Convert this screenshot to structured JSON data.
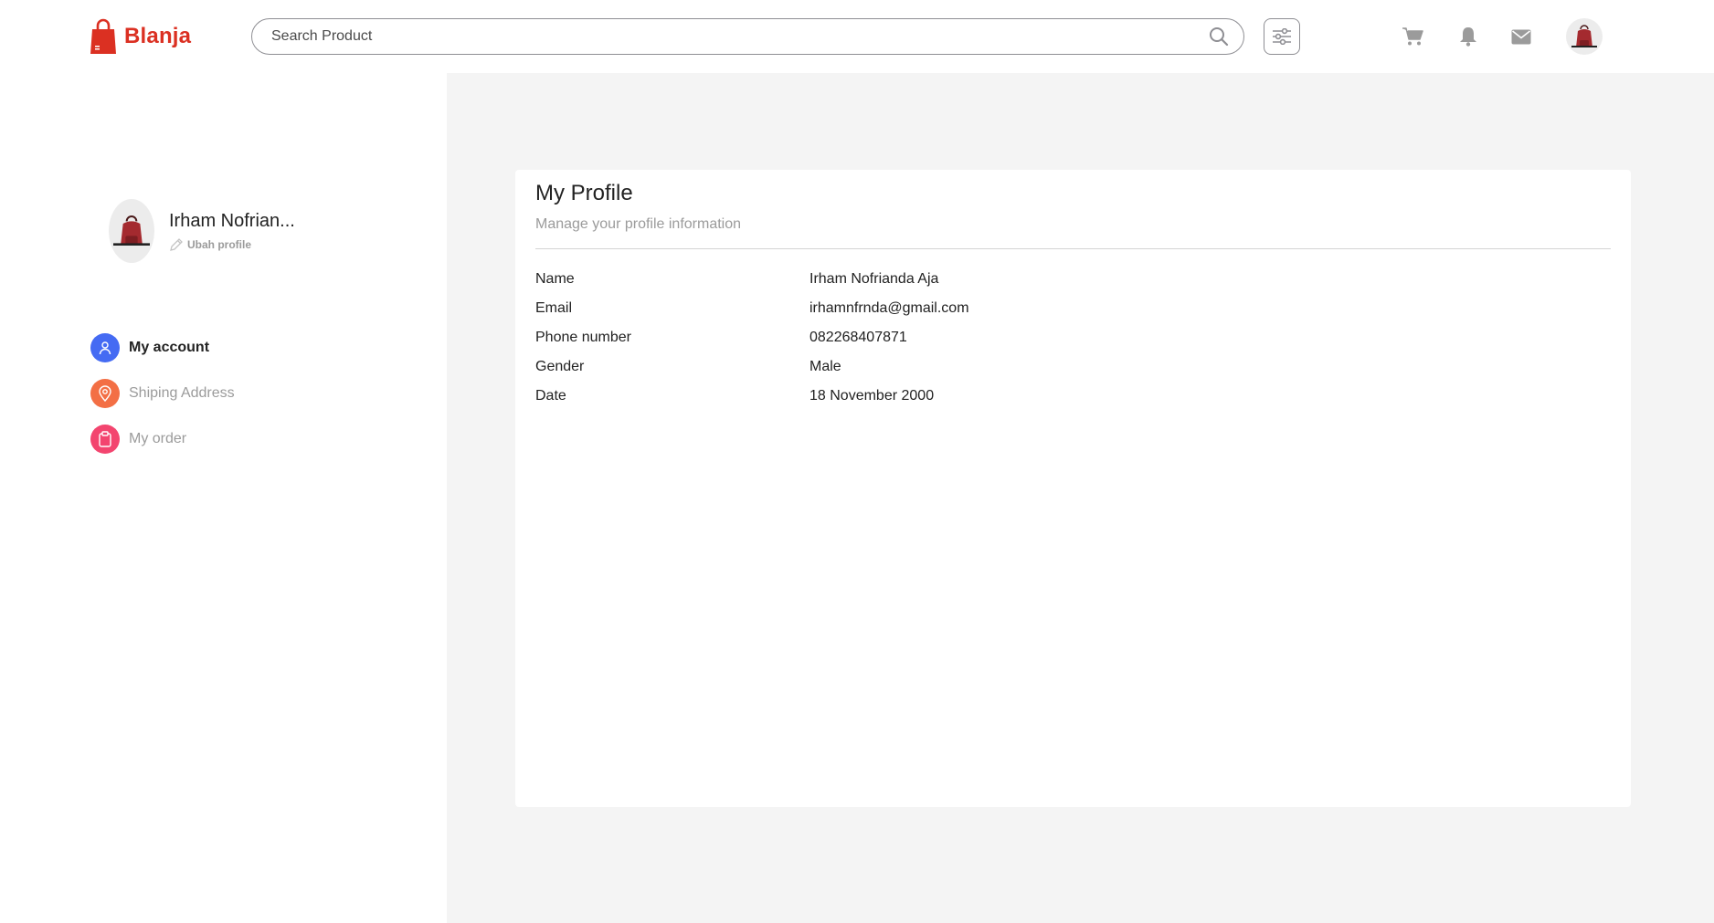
{
  "brand": {
    "name": "Blanja",
    "color": "#db3022"
  },
  "search": {
    "placeholder": "Search Product"
  },
  "header": {
    "icons": [
      "filter-icon",
      "cart-icon",
      "bell-icon",
      "mail-icon",
      "avatar"
    ]
  },
  "sidebar": {
    "user_name": "Irham Nofrian...",
    "edit_label": "Ubah profile",
    "items": [
      {
        "label": "My account",
        "icon": "user-icon",
        "color": "#456bf3",
        "active": true
      },
      {
        "label": "Shiping Address",
        "icon": "map-pin-icon",
        "color": "#f36f45",
        "active": false
      },
      {
        "label": "My order",
        "icon": "clipboard-icon",
        "color": "#f3456f",
        "active": false
      }
    ]
  },
  "profile": {
    "title": "My Profile",
    "subtitle": "Manage your profile information",
    "rows": [
      {
        "label": "Name",
        "value": "Irham Nofrianda Aja"
      },
      {
        "label": "Email",
        "value": "irhamnfrnda@gmail.com"
      },
      {
        "label": "Phone number",
        "value": "082268407871"
      },
      {
        "label": "Gender",
        "value": "Male"
      },
      {
        "label": "Date",
        "value": "18 November 2000"
      }
    ]
  },
  "colors": {
    "accent": "#db3022",
    "main_bg": "#f4f4f4",
    "muted_text": "#9b9b9b"
  }
}
